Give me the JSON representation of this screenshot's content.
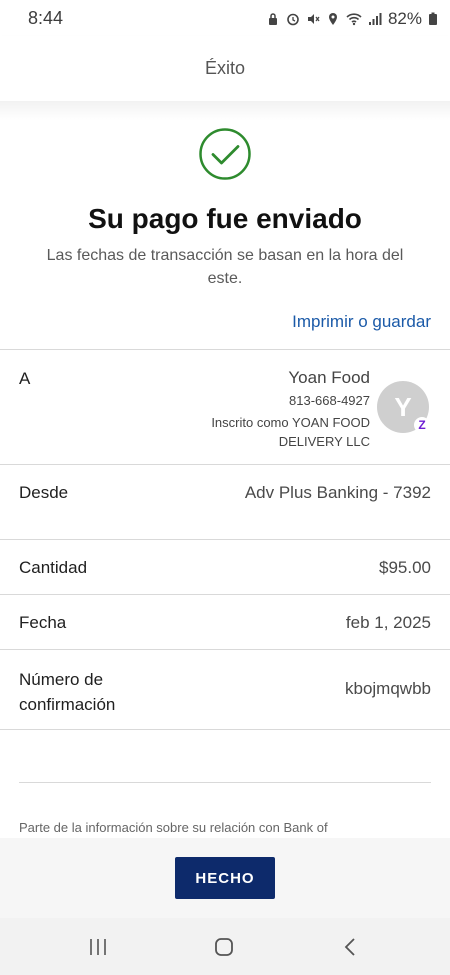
{
  "status_bar": {
    "time": "8:44",
    "battery": "82%"
  },
  "header": {
    "title": "Éxito"
  },
  "success": {
    "headline": "Su pago fue enviado",
    "subtext": "Las fechas de transacción se basan en la hora del este.",
    "print_link": "Imprimir o guardar"
  },
  "details": {
    "to": {
      "label": "A",
      "name": "Yoan Food",
      "phone": "813-668-4927",
      "enrolled_as": "Inscrito como YOAN FOOD DELIVERY LLC",
      "avatar_initial": "Y",
      "badge": "Z"
    },
    "from": {
      "label": "Desde",
      "value": "Adv Plus Banking - 7392"
    },
    "amount": {
      "label": "Cantidad",
      "value": "$95.00"
    },
    "date": {
      "label": "Fecha",
      "value": "feb 1, 2025"
    },
    "confirmation": {
      "label": "Número de confirmación",
      "value": "kbojmqwbb"
    }
  },
  "disclaimer": "Parte de la información sobre su relación con Bank of",
  "footer": {
    "done_label": "HECHO"
  },
  "colors": {
    "accent": "#1b5aa8",
    "button": "#0d2a6b",
    "success": "#2e8b2e"
  }
}
